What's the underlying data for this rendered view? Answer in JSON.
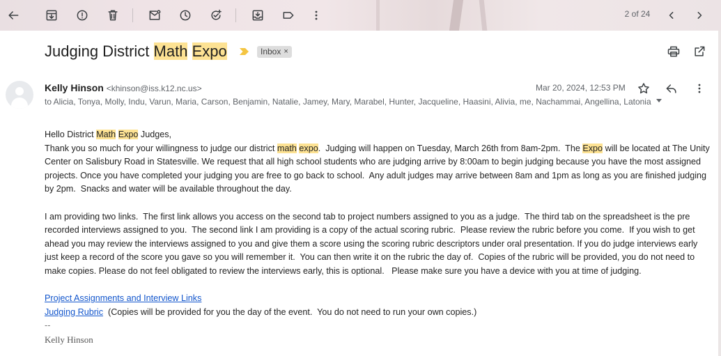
{
  "toolbar": {
    "pager_text": "2 of 24"
  },
  "message": {
    "subject_parts": [
      "Judging District ",
      "Math",
      " ",
      "Expo"
    ],
    "label": "Inbox",
    "label_remove": "×",
    "sender_name": "Kelly Hinson",
    "sender_email": "<khinson@iss.k12.nc.us>",
    "recipients": "to Alicia, Tonya, Molly, Indu, Varun, Maria, Carson, Benjamin, Natalie, Jamey, Mary, Marabel, Hunter, Jacqueline, Haasini, Alivia, me, Nachammai, Angellina, Latonia",
    "date": "Mar 20, 2024, 12:53 PM"
  },
  "body": {
    "greeting": [
      "Hello District ",
      "Math",
      " ",
      "Expo",
      " Judges,"
    ],
    "p1": [
      "Thank you so much for your willingness to judge our district ",
      "math",
      " ",
      "expo",
      ".  Judging will happen on Tuesday, March 26th from 8am-2pm.  The ",
      "Expo",
      " will be located at The Unity Center on Salisbury Road in Statesville. We request that all high school students who are judging arrive by 8:00am to begin judging because you have the most assigned projects. Once you have completed your judging you are free to go back to school.  Any adult judges may arrive between 8am and 1pm as long as you are finished judging by 2pm.  Snacks and water will be available throughout the day."
    ],
    "p2": "I am providing two links.  The first link allows you access on the second tab to project numbers assigned to you as a judge.  The third tab on the spreadsheet is the pre recorded interviews assigned to you.  The second link I am providing is a copy of the actual scoring rubric.  Please review the rubric before you come.  If you wish to get ahead you may review the interviews assigned to you and give them a score using the scoring rubric descriptors under oral presentation. If you do judge interviews early just keep a record of the score you gave so you will remember it.  You can then write it on the rubric the day of.  Copies of the rubric will be provided, you do not need to make copies. Please do not feel obligated to review the interviews early, this is optional.   Please make sure you have a device with you at time of judging.",
    "link1": "Project Assignments and Interview Links",
    "link2": "Judging Rubric",
    "link2_note": "  (Copies will be provided for you the day of the event.  You do not need to run your own copies.)",
    "sig_dash": "--",
    "sig_name": "Kelly Hinson"
  }
}
